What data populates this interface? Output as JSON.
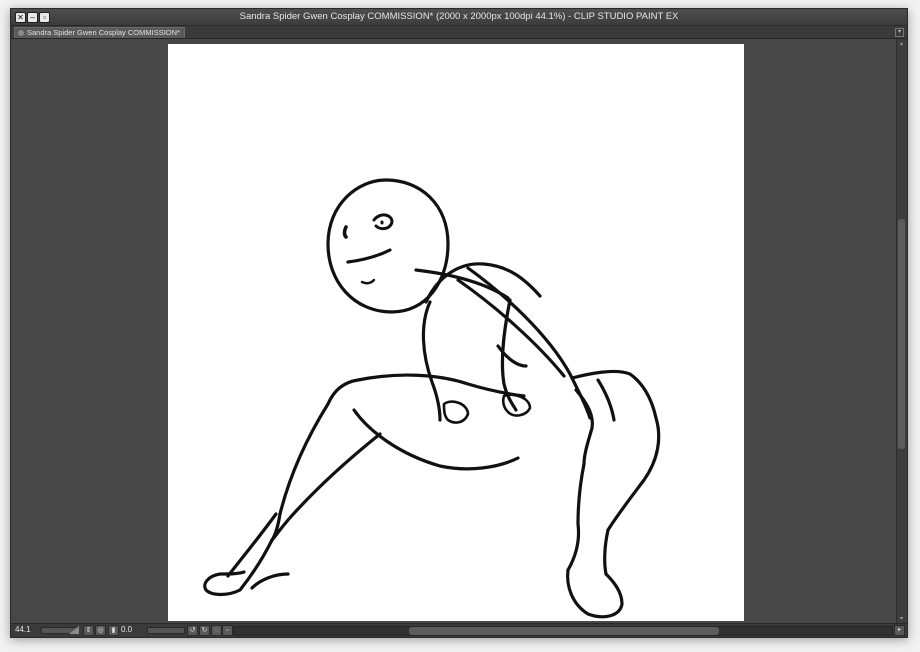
{
  "window": {
    "title": "Sandra Spider Gwen Cosplay COMMISSION* (2000 x 2000px 100dpi 44.1%)  - CLIP STUDIO PAINT EX",
    "close_glyph": "✕",
    "minimize_glyph": "–",
    "maximize_glyph": "▫"
  },
  "tabs": [
    {
      "label": "Sandra Spider Gwen Cosplay COMMISSION*",
      "active": true
    }
  ],
  "canvas": {
    "paper_color": "#ffffff",
    "background_color": "#474747",
    "stroke_color": "#111111"
  },
  "statusbar": {
    "zoom": "44.1",
    "rotation": "0.0",
    "icons": [
      "zoom-stepper-icon",
      "fit-icon",
      "rotate-left-icon",
      "rotate-right-icon",
      "reset-rotation-icon",
      "flip-icon"
    ]
  }
}
